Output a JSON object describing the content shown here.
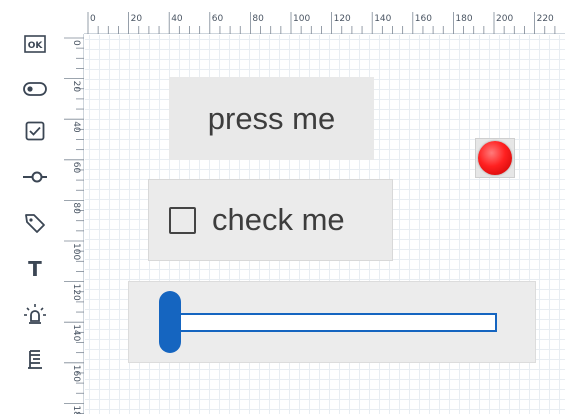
{
  "palette": {
    "tools": [
      {
        "name": "button-tool",
        "icon": "button-ok-icon",
        "glyph": "OK"
      },
      {
        "name": "toggle-tool",
        "icon": "switch-icon"
      },
      {
        "name": "checkbox-tool",
        "icon": "checkbox-icon"
      },
      {
        "name": "slider-tool",
        "icon": "slider-icon"
      },
      {
        "name": "tag-tool",
        "icon": "tag-icon"
      },
      {
        "name": "text-tool",
        "icon": "text-icon",
        "glyph": "T"
      },
      {
        "name": "led-tool",
        "icon": "light-bulb-icon"
      },
      {
        "name": "gauge-tool",
        "icon": "bar-gauge-icon"
      }
    ]
  },
  "ruler": {
    "top_labels": [
      "0",
      "20",
      "40",
      "60",
      "80",
      "100",
      "120",
      "140",
      "160",
      "180",
      "200",
      "220"
    ],
    "left_labels": [
      "0",
      "20",
      "40",
      "60",
      "80",
      "100",
      "120",
      "140",
      "160",
      "18"
    ]
  },
  "canvas": {
    "button": {
      "label": "press me"
    },
    "checkbox": {
      "label": "check me",
      "checked": false
    },
    "slider": {
      "value": 0,
      "accent": "#1565c0"
    },
    "led": {
      "color": "#ff2020",
      "state": "on"
    }
  }
}
